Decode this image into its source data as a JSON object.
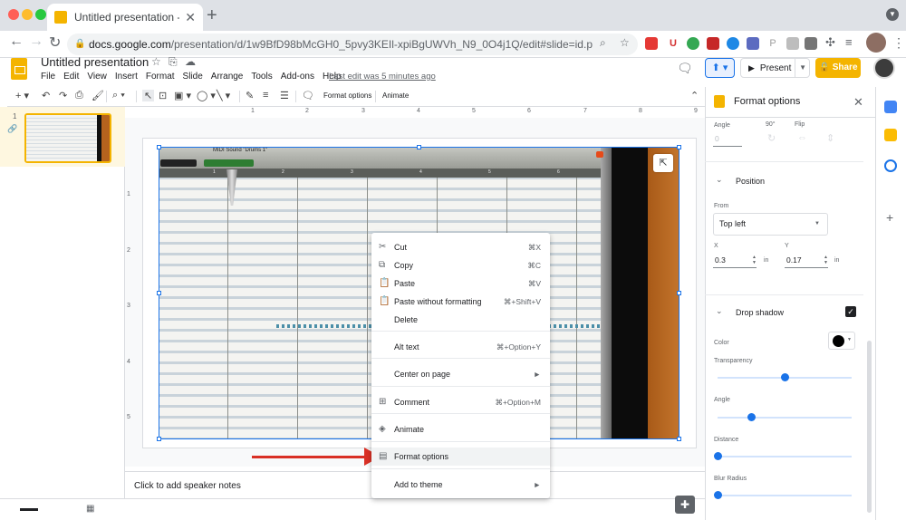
{
  "browser": {
    "tab_title": "Untitled presentation - Google Slides",
    "url_host": "docs.google.com",
    "url_path": "/presentation/d/1w9BfD98bMcGH0_5pvy3KEIl-xpiBgUWVh_N9_0O4j1Q/edit#slide=id.p"
  },
  "app": {
    "title": "Untitled presentation",
    "menu": [
      "File",
      "Edit",
      "View",
      "Insert",
      "Format",
      "Slide",
      "Arrange",
      "Tools",
      "Add-ons",
      "Help"
    ],
    "last_edit": "Last edit was 5 minutes ago",
    "present_label": "Present",
    "share_label": "Share",
    "accent_color": "#f4b400"
  },
  "toolbar": {
    "format_options": "Format options",
    "animate": "Animate"
  },
  "filmstrip": {
    "slide_number": "1"
  },
  "ruler": {
    "top": [
      "1",
      "2",
      "3",
      "4",
      "5",
      "6",
      "7",
      "8",
      "9"
    ],
    "left": [
      "1",
      "2",
      "3",
      "4",
      "5"
    ]
  },
  "photo": {
    "title_text": "MIDI Sound \"Drums 1\"",
    "bar_numbers": [
      "1",
      "2",
      "3",
      "4",
      "5",
      "6"
    ]
  },
  "notes": {
    "placeholder": "Click to add speaker notes"
  },
  "context_menu": {
    "items": [
      {
        "label": "Cut",
        "shortcut": "⌘X",
        "icon": "scissors-icon"
      },
      {
        "label": "Copy",
        "shortcut": "⌘C",
        "icon": "copy-icon"
      },
      {
        "label": "Paste",
        "shortcut": "⌘V",
        "icon": "clipboard-icon"
      },
      {
        "label": "Paste without formatting",
        "shortcut": "⌘+Shift+V",
        "icon": "clipboard-icon"
      },
      {
        "label": "Delete",
        "shortcut": "",
        "icon": ""
      },
      {
        "label": "Alt text",
        "shortcut": "⌘+Option+Y",
        "icon": ""
      },
      {
        "label": "Center on page",
        "shortcut": "►",
        "icon": ""
      },
      {
        "label": "Comment",
        "shortcut": "⌘+Option+M",
        "icon": "comment-icon"
      },
      {
        "label": "Animate",
        "shortcut": "",
        "icon": "animate-icon"
      },
      {
        "label": "Format options",
        "shortcut": "",
        "icon": "format-options-icon"
      },
      {
        "label": "Add to theme",
        "shortcut": "►",
        "icon": ""
      }
    ]
  },
  "panel": {
    "title": "Format options",
    "angle_label": "Angle",
    "angle_value": "0",
    "angle_90": "90°",
    "flip_label": "Flip",
    "position": {
      "header": "Position",
      "from_label": "From",
      "from_value": "Top left",
      "x_label": "X",
      "x_value": "0.3",
      "y_label": "Y",
      "y_value": "0.17",
      "unit": "in"
    },
    "drop_shadow": {
      "header": "Drop shadow",
      "enabled": true,
      "color_label": "Color",
      "color_value": "#000000",
      "transparency_label": "Transparency",
      "transparency": 0.5,
      "angle_label": "Angle",
      "angle": 0.25,
      "distance_label": "Distance",
      "distance": 0.0,
      "blur_label": "Blur Radius",
      "blur": 0.0
    }
  }
}
